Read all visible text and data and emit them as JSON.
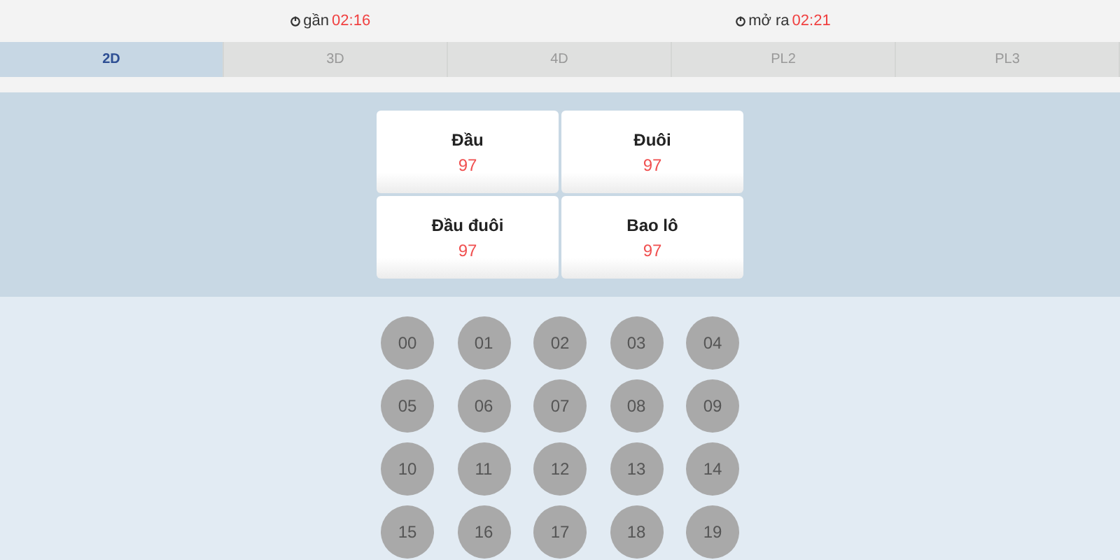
{
  "timers": [
    {
      "label": "gần",
      "time": "02:16"
    },
    {
      "label": "mở ra",
      "time": "02:21"
    }
  ],
  "tabs": [
    {
      "label": "2D",
      "selected": true
    },
    {
      "label": "3D",
      "selected": false
    },
    {
      "label": "4D",
      "selected": false
    },
    {
      "label": "PL2",
      "selected": false
    },
    {
      "label": "PL3",
      "selected": false
    }
  ],
  "bet_types": [
    {
      "name": "Đầu",
      "odds": "97"
    },
    {
      "name": "Đuôi",
      "odds": "97"
    },
    {
      "name": "Đầu đuôi",
      "odds": "97"
    },
    {
      "name": "Bao lô",
      "odds": "97"
    }
  ],
  "numbers": [
    "00",
    "01",
    "02",
    "03",
    "04",
    "05",
    "06",
    "07",
    "08",
    "09",
    "10",
    "11",
    "12",
    "13",
    "14",
    "15",
    "16",
    "17",
    "18",
    "19"
  ]
}
